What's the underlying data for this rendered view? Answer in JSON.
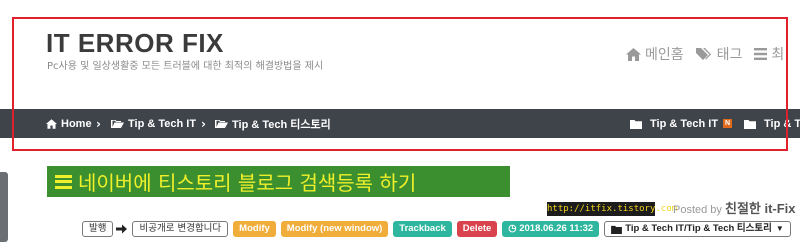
{
  "header": {
    "site_title": "IT ERROR FIX",
    "site_description": "Pc사용 및 일상생활중 모든 트러블에 대한 최적의 해결방법을 제시"
  },
  "topnav": {
    "items": [
      {
        "label": "메인홈",
        "icon": "home-icon"
      },
      {
        "label": "태그",
        "icon": "tags-icon"
      },
      {
        "label": "최",
        "icon": "list-icon"
      }
    ]
  },
  "breadcrumb": {
    "home": "Home",
    "level1": "Tip & Tech IT",
    "level2": "Tip & Tech 티스토리"
  },
  "right_nav": {
    "item1": "Tip & Tech IT",
    "item1_badge": "N",
    "item2": "Tip & Tech"
  },
  "post": {
    "title": "네이버에 티스토리 블로그 검색등록 하기",
    "watermark": "http://itfix.tistory.com",
    "posted_by_label": "Posted by",
    "author": "친절한 it-Fix",
    "actions": {
      "publish": "발행",
      "make_private": "비공개로 변경합니다",
      "modify": "Modify",
      "modify_new_window": "Modify (new window)",
      "trackback": "Trackback",
      "delete": "Delete",
      "date": "2018.06.26 11:32",
      "category": "Tip & Tech IT/Tip & Tech 티스토리"
    }
  },
  "colors": {
    "nav_bar": "#3f434a",
    "title_bg": "#3c8f2f",
    "title_text": "#f0f02a",
    "annotation": "#e0202b"
  }
}
